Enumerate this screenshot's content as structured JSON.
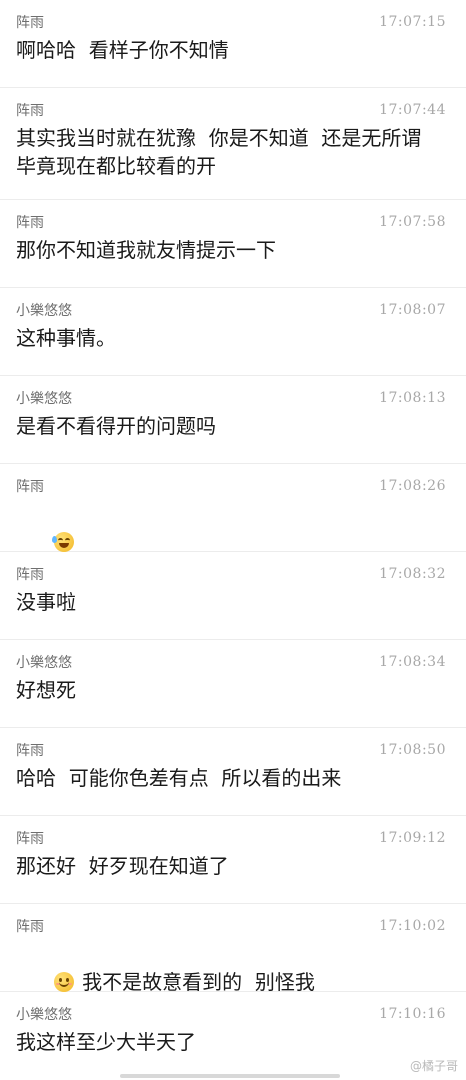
{
  "messages": [
    {
      "sender": "阵雨",
      "time": "17:07:15",
      "text": "啊哈哈  看样子你不知情"
    },
    {
      "sender": "阵雨",
      "time": "17:07:44",
      "text": "其实我当时就在犹豫  你是不知道  还是无所谓  毕竟现在都比较看的开"
    },
    {
      "sender": "阵雨",
      "time": "17:07:58",
      "text": "那你不知道我就友情提示一下"
    },
    {
      "sender": "小樂悠悠",
      "time": "17:08:07",
      "text": "这种事情。"
    },
    {
      "sender": "小樂悠悠",
      "time": "17:08:13",
      "text": "是看不看得开的问题吗"
    },
    {
      "sender": "阵雨",
      "time": "17:08:26",
      "text": "",
      "emoji": "laugh-cry-icon"
    },
    {
      "sender": "阵雨",
      "time": "17:08:32",
      "text": "没事啦"
    },
    {
      "sender": "小樂悠悠",
      "time": "17:08:34",
      "text": "好想死"
    },
    {
      "sender": "阵雨",
      "time": "17:08:50",
      "text": "哈哈  可能你色差有点  所以看的出来"
    },
    {
      "sender": "阵雨",
      "time": "17:09:12",
      "text": "那还好  好歹现在知道了"
    },
    {
      "sender": "阵雨",
      "time": "17:10:02",
      "text": "我不是故意看到的  别怪我",
      "emoji": "smile-icon"
    },
    {
      "sender": "小樂悠悠",
      "time": "17:10:16",
      "text": "我这样至少大半天了"
    }
  ],
  "watermark": "@橘子哥"
}
